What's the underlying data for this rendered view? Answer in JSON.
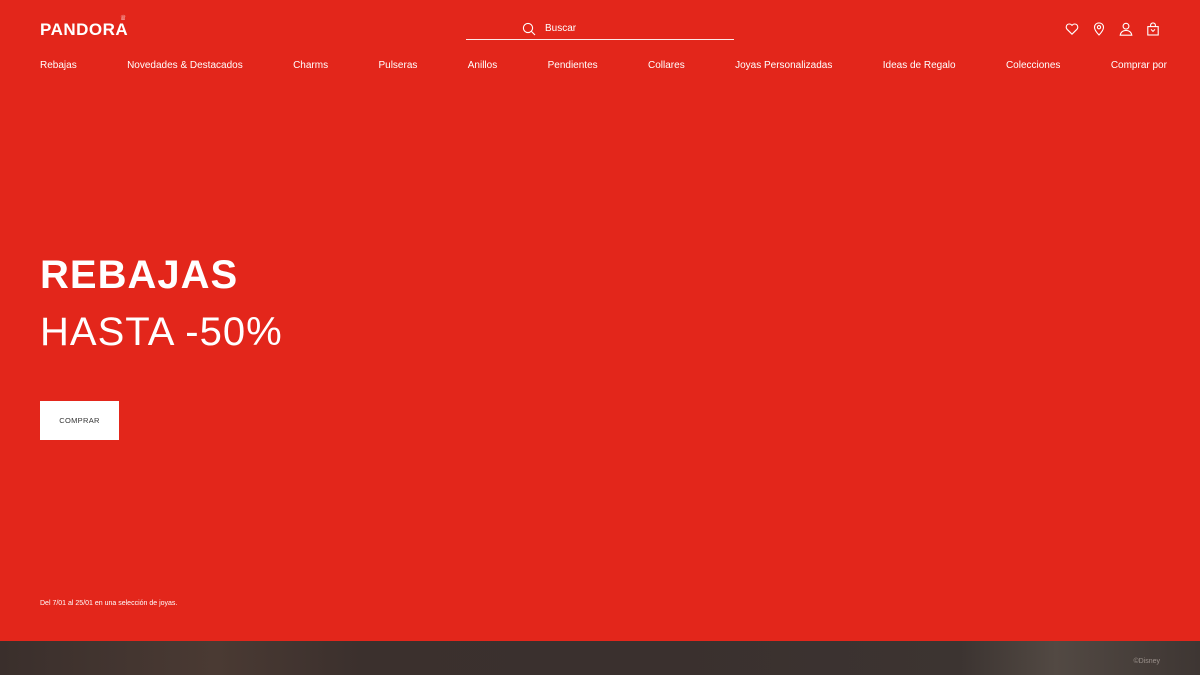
{
  "header": {
    "logo_text": "PANDORA",
    "search": {
      "placeholder": "Buscar"
    },
    "icons": [
      "heart-icon",
      "location-icon",
      "user-icon",
      "bag-icon"
    ]
  },
  "nav": {
    "items": [
      "Rebajas",
      "Novedades & Destacados",
      "Charms",
      "Pulseras",
      "Anillos",
      "Pendientes",
      "Collares",
      "Joyas Personalizadas",
      "Ideas de Regalo",
      "Colecciones",
      "Comprar por"
    ]
  },
  "hero": {
    "title": "REBAJAS",
    "subtitle": "HASTA -50%",
    "cta_label": "COMPRAR",
    "disclaimer": "Del 7/01 al 25/01 en una selección de joyas."
  },
  "footer_strip": {
    "copyright": "©Disney"
  },
  "colors": {
    "brand_red": "#e3261b",
    "white": "#ffffff"
  }
}
